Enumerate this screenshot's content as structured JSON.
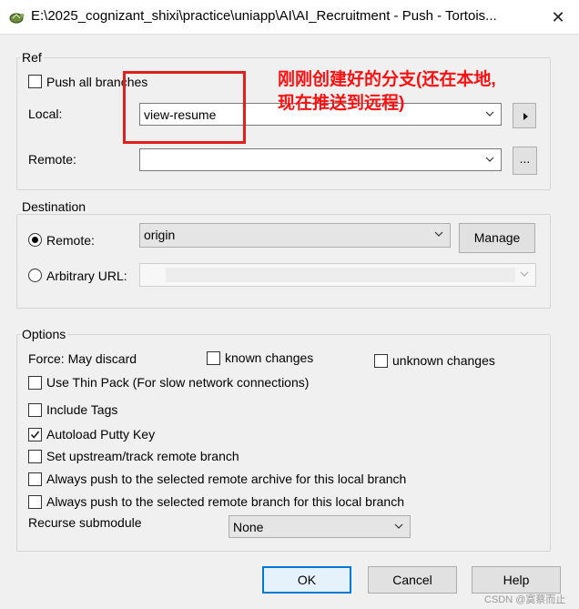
{
  "window": {
    "title": "E:\\2025_cognizant_shixi\\practice\\uniapp\\AI\\AI_Recruitment - Push - Tortois...",
    "close_glyph": "✕",
    "app_icon": "tortoisegit-icon"
  },
  "ref": {
    "group_label": "Ref",
    "push_all_branches_label": "Push all branches",
    "push_all_branches_checked": false,
    "local_label": "Local:",
    "local_value": "view-resume",
    "local_arrow": "▸",
    "remote_label": "Remote:",
    "remote_value": "",
    "browse_label": "..."
  },
  "destination": {
    "group_label": "Destination",
    "remote_radio_label": "Remote:",
    "remote_radio_selected": true,
    "remote_value": "origin",
    "manage_label": "Manage",
    "arbitrary_url_label": "Arbitrary URL:",
    "arbitrary_url_value": ""
  },
  "options": {
    "group_label": "Options",
    "force_label": "Force: May discard",
    "known_changes_label": "known changes",
    "unknown_changes_label": "unknown changes",
    "thin_pack_label": "Use Thin Pack (For slow network connections)",
    "include_tags_label": "Include Tags",
    "autoload_putty_label": "Autoload Putty Key",
    "autoload_putty_checked": true,
    "set_upstream_label": "Set upstream/track remote branch",
    "always_push_archive_label": "Always push to the selected remote archive for this local branch",
    "always_push_branch_label": "Always push to the selected remote branch for this local branch",
    "recurse_label": "Recurse submodule",
    "recurse_value": "None"
  },
  "footer": {
    "ok_label": "OK",
    "cancel_label": "Cancel",
    "help_label": "Help"
  },
  "annotation": {
    "line1": "刚刚创建好的分支(还在本地,",
    "line2": "现在推送到远程)",
    "color": "#ff1010"
  },
  "watermark": "CSDN @寞蔡而止"
}
